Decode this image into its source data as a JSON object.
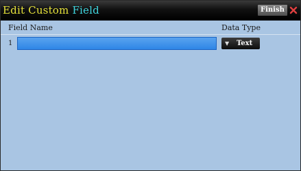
{
  "window": {
    "title_part1": "Edit Custom",
    "title_part2": "Field",
    "finish_label": "Finish",
    "close_symbol": "×"
  },
  "table": {
    "columns": [
      "Field Name",
      "Data Type"
    ],
    "rows": [
      {
        "index": "1",
        "field_name": "",
        "data_type": "Text"
      }
    ]
  },
  "colors": {
    "panel_bg": "#a9c5e3",
    "title_yellow": "#e6e23a",
    "title_cyan": "#3fd7e0",
    "input_blue": "#3b8fe8",
    "close_red": "#e04040"
  }
}
